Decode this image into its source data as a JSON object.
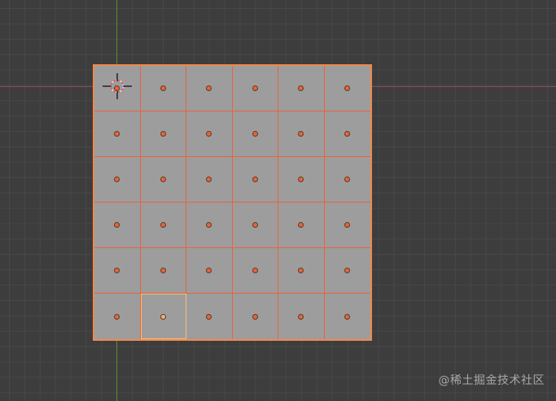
{
  "viewport": {
    "name": "3d-viewport",
    "axes": {
      "x_color": "#8f4a57",
      "y_color": "#5d8a2e"
    },
    "grid_color": "#474747",
    "background": "#3d3d3d"
  },
  "mesh": {
    "rows": 6,
    "cols": 6,
    "face_color": "#9d9d9d",
    "edge_color": "#e8643a",
    "selection_color": "#f08a4b",
    "active_face": {
      "row": 5,
      "col": 1
    }
  },
  "cursor": {
    "icon": "3d-cursor-icon"
  },
  "watermark": {
    "text": "@稀土掘金技术社区"
  }
}
